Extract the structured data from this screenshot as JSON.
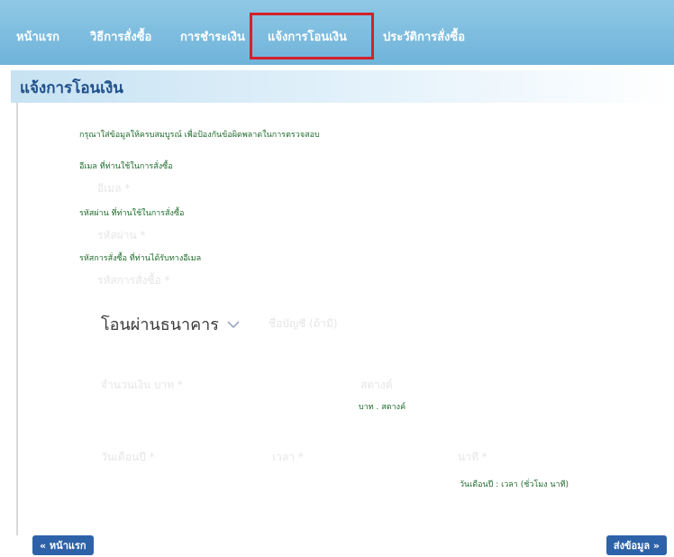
{
  "nav": {
    "items": [
      {
        "label": "หน้าแรก"
      },
      {
        "label": "วิธีการสั่งซื้อ"
      },
      {
        "label": "การชำระเงิน"
      },
      {
        "label": "แจ้งการโอนเงิน"
      },
      {
        "label": "ประวัติการสั่งซื้อ"
      }
    ],
    "highlight_color": "#d4212a"
  },
  "page": {
    "title": "แจ้งการโอนเงิน",
    "intro": "กรุณาใส่ข้อมูลให้ครบสมบูรณ์ เพื่อป้องกันข้อผิดพลาดในการตรวจสอบ"
  },
  "form": {
    "email_label": "อีเมล ที่ท่านใช้ในการสั่งซื้อ",
    "email_placeholder": "อีเมล *",
    "password_label": "รหัสผ่าน ที่ท่านใช้ในการสั่งซื้อ",
    "password_placeholder": "รหัสผ่าน *",
    "order_label": "รหัสการสั่งซื้อ ที่ท่านได้รับทางอีเมล",
    "order_placeholder": "รหัสการสั่งซื้อ *",
    "bank_select_value": "โอนผ่านธนาคาร",
    "account_placeholder": "ชื่อบัญชี (ถ้ามี)",
    "amount_placeholder": "จำนวนเงิน บาท *",
    "satang_placeholder": "สตางค์",
    "amount_hint": "บาท . สตางค์",
    "date_placeholder": "วันเดือนปี *",
    "time_placeholder": "เวลา *",
    "minute_placeholder": "นาที *",
    "datetime_hint": "วันเดือนปี : เวลา (ชั่วโมง นาที)"
  },
  "buttons": {
    "home": "« หน้าแรก",
    "submit": "ส่งข้อมูล »"
  },
  "colors": {
    "nav_bg": "#6fb3d9",
    "title": "#1e4f8a",
    "label_green": "#1f6b2c",
    "button_blue": "#2d62a8"
  }
}
